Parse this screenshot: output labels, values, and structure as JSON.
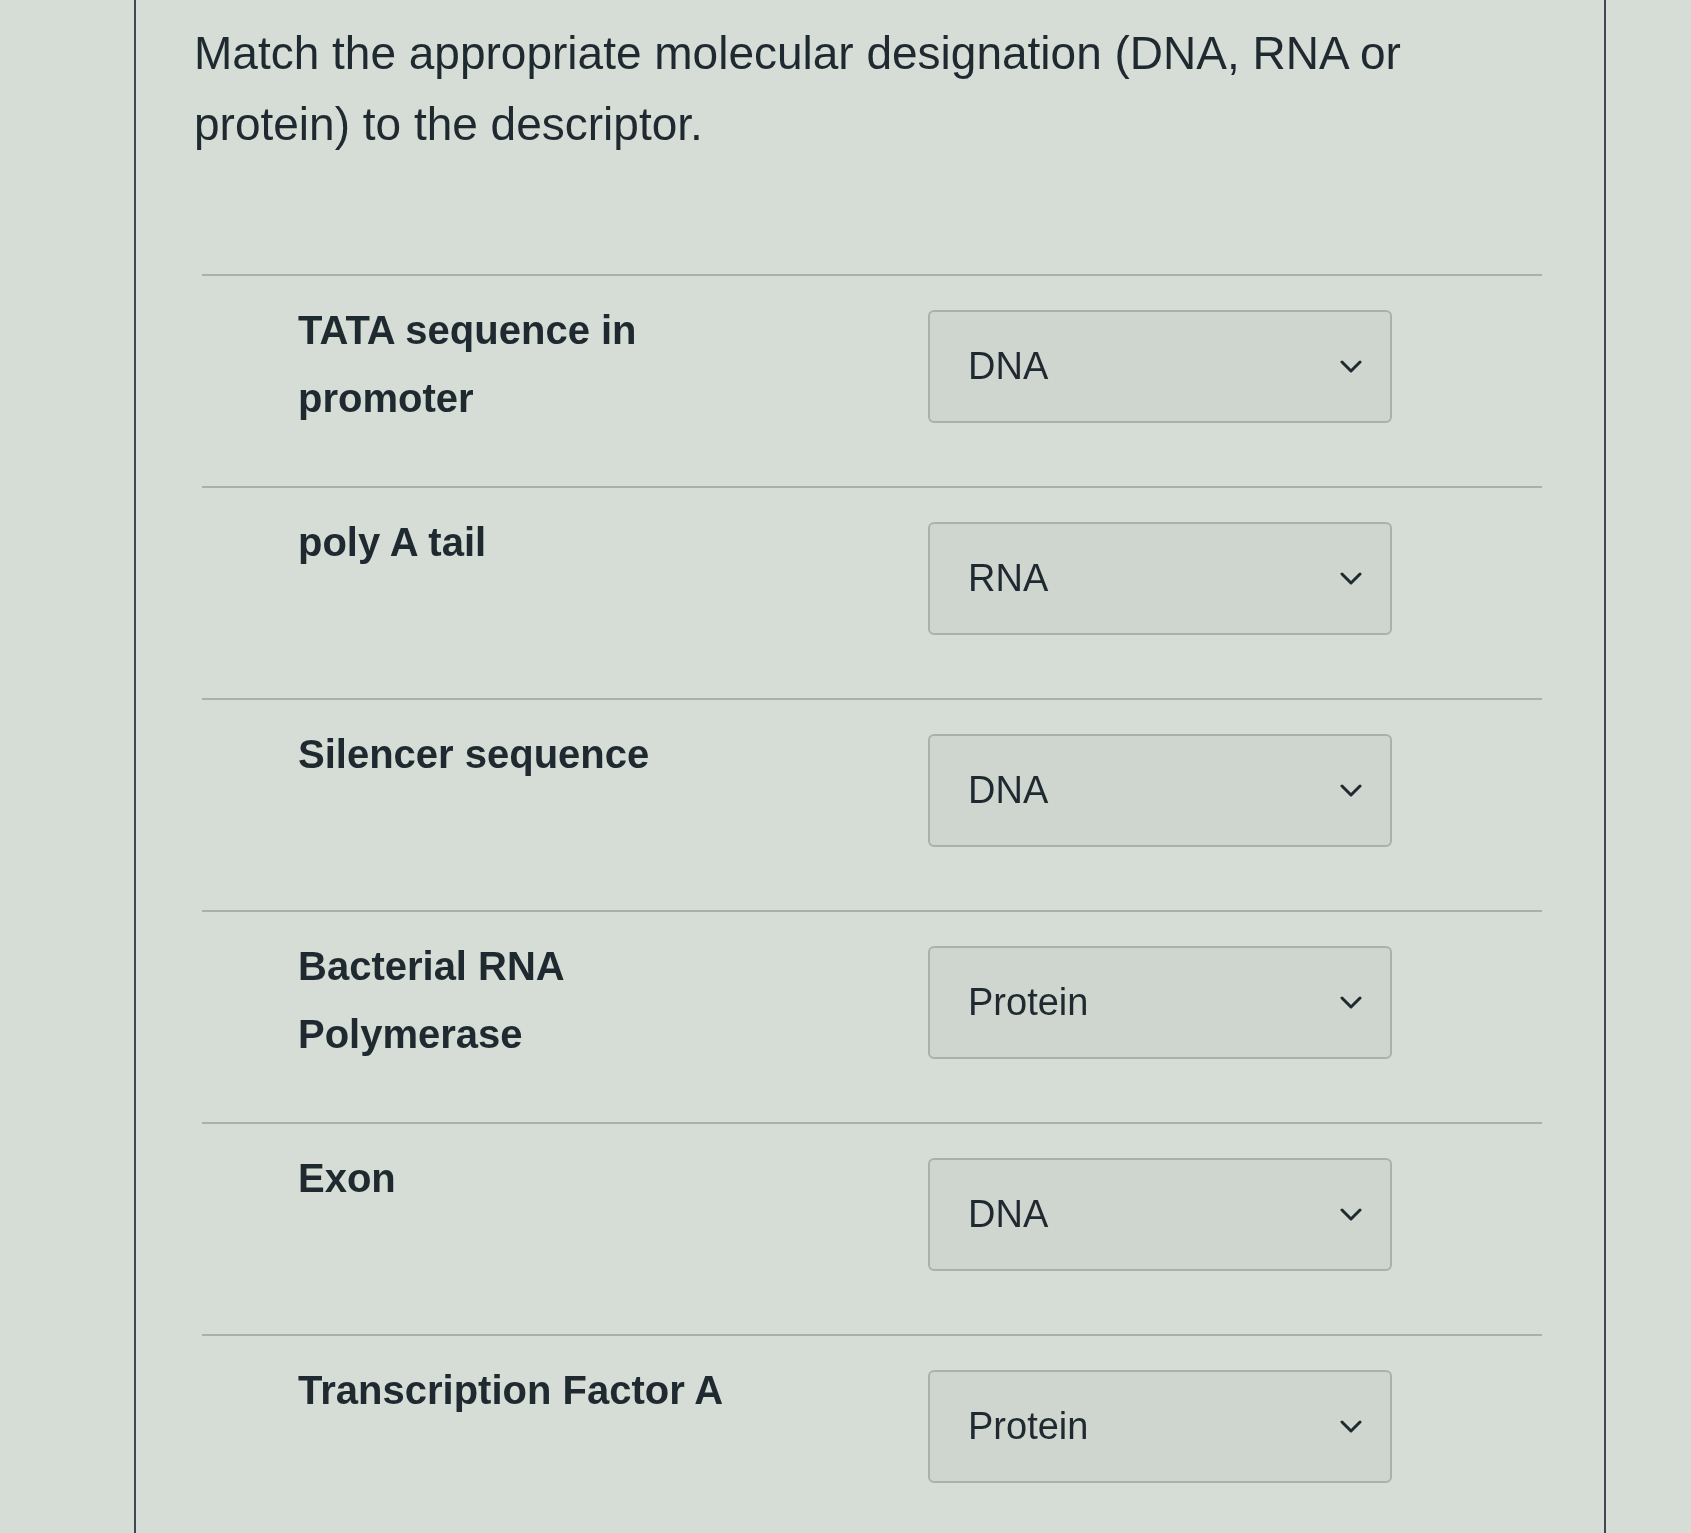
{
  "question": {
    "text": "Match the appropriate molecular designation (DNA, RNA or protein) to the descriptor."
  },
  "rows": [
    {
      "descriptor": "TATA sequence in promoter",
      "answer": "DNA"
    },
    {
      "descriptor": "poly A tail",
      "answer": "RNA"
    },
    {
      "descriptor": "Silencer sequence",
      "answer": "DNA"
    },
    {
      "descriptor": "Bacterial RNA Polymerase",
      "answer": "Protein"
    },
    {
      "descriptor": "Exon",
      "answer": "DNA"
    },
    {
      "descriptor": "Transcription Factor A",
      "answer": "Protein"
    }
  ]
}
